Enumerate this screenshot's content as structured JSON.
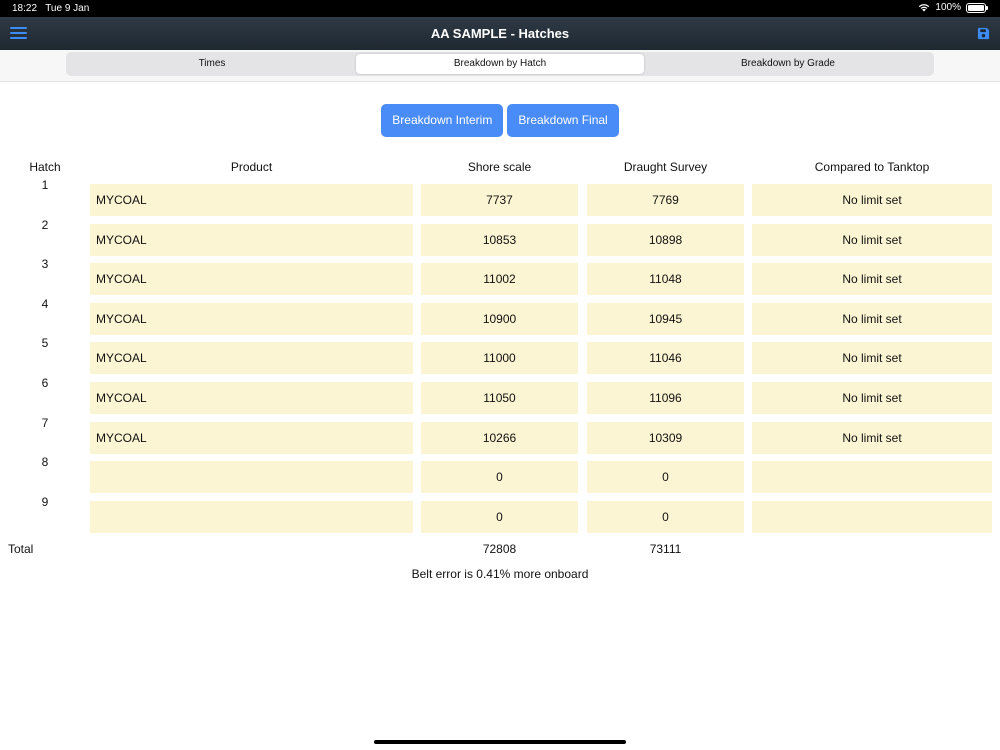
{
  "status": {
    "time": "18:22",
    "date": "Tue 9 Jan",
    "battery": "100%"
  },
  "nav": {
    "title": "AA SAMPLE - Hatches",
    "accent": "#3d8bf5"
  },
  "tabs": [
    {
      "label": "Times",
      "active": false
    },
    {
      "label": "Breakdown by Hatch",
      "active": true
    },
    {
      "label": "Breakdown by Grade",
      "active": false
    }
  ],
  "buttons": {
    "interim": "Breakdown Interim",
    "final": "Breakdown Final",
    "color": "#4a8cf7"
  },
  "table": {
    "headers": {
      "hatch": "Hatch",
      "product": "Product",
      "shore": "Shore scale",
      "draught": "Draught Survey",
      "compared": "Compared to Tanktop"
    },
    "rows": [
      {
        "hatch": "1",
        "product": "MYCOAL",
        "shore": "7737",
        "draught": "7769",
        "compared": "No limit set"
      },
      {
        "hatch": "2",
        "product": "MYCOAL",
        "shore": "10853",
        "draught": "10898",
        "compared": "No limit set"
      },
      {
        "hatch": "3",
        "product": "MYCOAL",
        "shore": "11002",
        "draught": "11048",
        "compared": "No limit set"
      },
      {
        "hatch": "4",
        "product": "MYCOAL",
        "shore": "10900",
        "draught": "10945",
        "compared": "No limit set"
      },
      {
        "hatch": "5",
        "product": "MYCOAL",
        "shore": "11000",
        "draught": "11046",
        "compared": "No limit set"
      },
      {
        "hatch": "6",
        "product": "MYCOAL",
        "shore": "11050",
        "draught": "11096",
        "compared": "No limit set"
      },
      {
        "hatch": "7",
        "product": "MYCOAL",
        "shore": "10266",
        "draught": "10309",
        "compared": "No limit set"
      },
      {
        "hatch": "8",
        "product": "",
        "shore": "0",
        "draught": "0",
        "compared": ""
      },
      {
        "hatch": "9",
        "product": "",
        "shore": "0",
        "draught": "0",
        "compared": ""
      }
    ],
    "cell_color": "#fcf5d3"
  },
  "totals": {
    "label": "Total",
    "shore": "72808",
    "draught": "73111"
  },
  "belt_error": "Belt error is 0.41% more onboard",
  "icons": {
    "menu": "hamburger-menu-icon",
    "save": "floppy-disk-icon",
    "wifi": "wifi-icon",
    "battery": "battery-icon"
  }
}
